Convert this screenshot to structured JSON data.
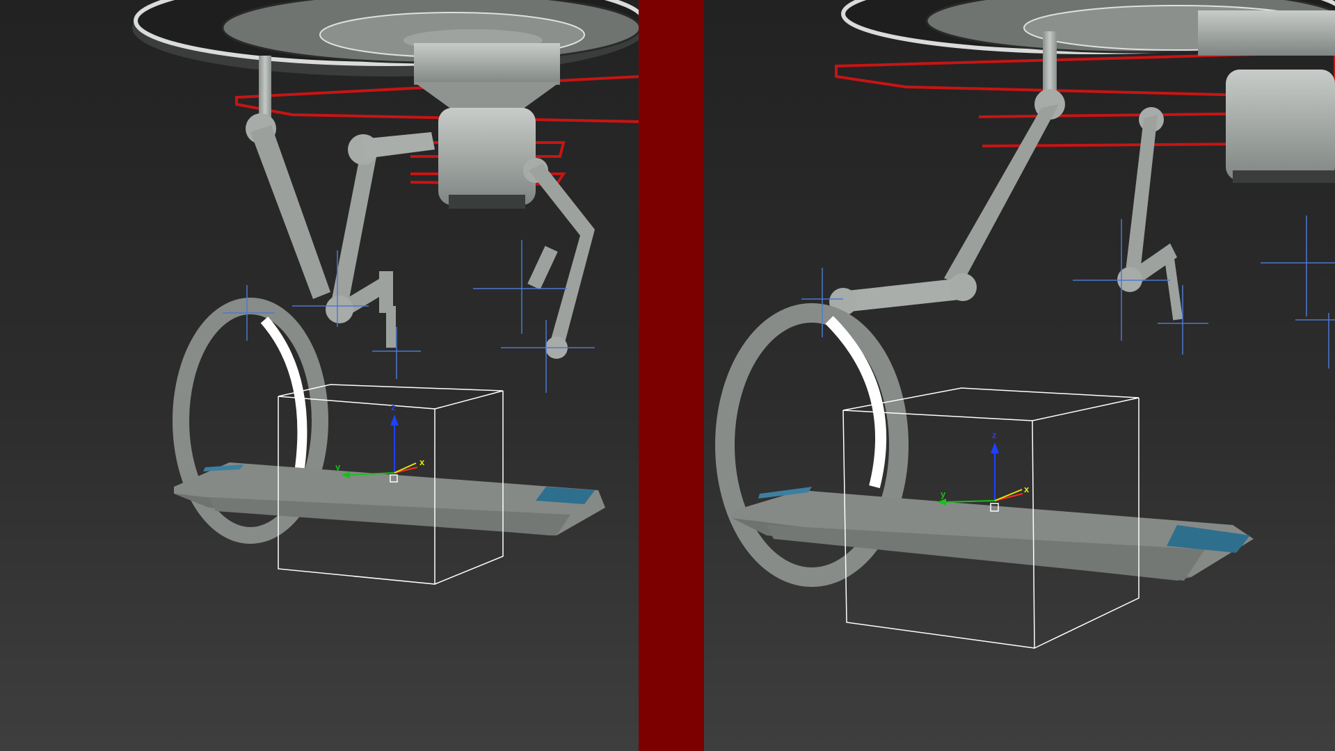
{
  "viewports": [
    {
      "id": "left",
      "gizmo_labels": {
        "x": "x",
        "y": "y",
        "z": "z"
      }
    },
    {
      "id": "right",
      "gizmo_labels": {
        "x": "x",
        "y": "y",
        "z": "z"
      }
    }
  ],
  "colors": {
    "divider": "#7d0000",
    "selection_box": "#ffffff",
    "spline_rings": "#c81414",
    "helpers": "#4d78d0",
    "model": "#a9aeab",
    "axis_x": "#ff2a2a",
    "axis_y": "#18c018",
    "axis_z": "#2040ff",
    "axis_label": "#e8e800"
  }
}
